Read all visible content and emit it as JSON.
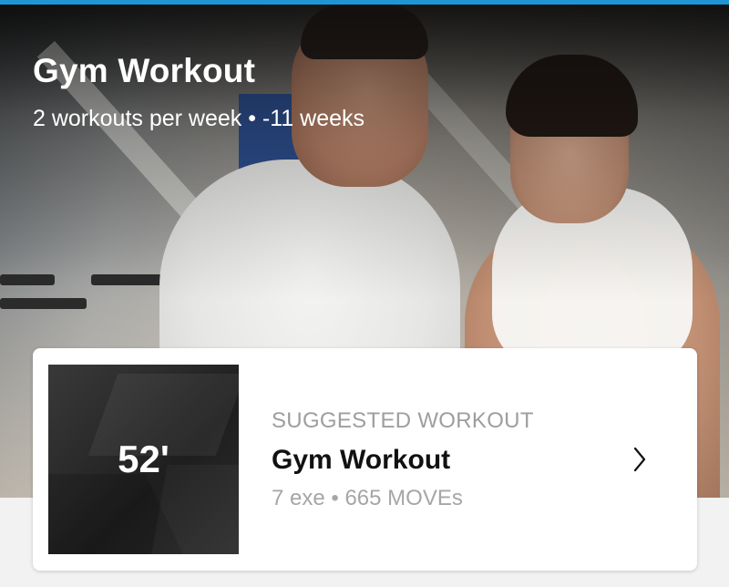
{
  "colors": {
    "accent": "#1e96d6",
    "card_background": "#ffffff",
    "page_background": "#f2f2f2",
    "eyebrow_text": "#9e9e9e",
    "title_text": "#111111"
  },
  "hero": {
    "title": "Gym Workout",
    "subtitle": "2 workouts per week • -11 weeks"
  },
  "suggested": {
    "duration": "52'",
    "label": "SUGGESTED WORKOUT",
    "title": "Gym Workout",
    "meta": "7 exe • 665 MOVEs",
    "chevron_icon": "chevron-right-icon"
  }
}
